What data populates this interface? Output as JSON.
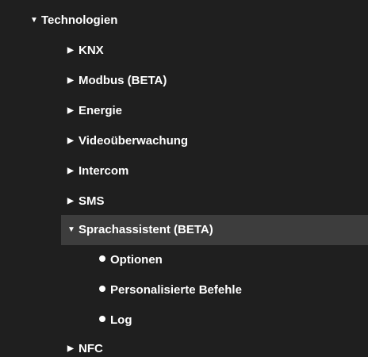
{
  "tree": {
    "root": {
      "label": "Technologien",
      "expand_icon": "triangle-down-icon"
    },
    "items": [
      {
        "label": "KNX",
        "icon": "triangle-right-icon"
      },
      {
        "label": "Modbus (BETA)",
        "icon": "triangle-right-icon"
      },
      {
        "label": "Energie",
        "icon": "triangle-right-icon"
      },
      {
        "label": "Videoüberwachung",
        "icon": "triangle-right-icon"
      },
      {
        "label": "Intercom",
        "icon": "triangle-right-icon"
      },
      {
        "label": "SMS",
        "icon": "triangle-right-icon"
      },
      {
        "label": "Sprachassistent (BETA)",
        "icon": "triangle-down-icon",
        "expanded": true,
        "children": [
          {
            "label": "Optionen",
            "icon": "bullet-icon"
          },
          {
            "label": "Personalisierte Befehle",
            "icon": "bullet-icon"
          },
          {
            "label": "Log",
            "icon": "bullet-icon"
          }
        ]
      },
      {
        "label": "NFC",
        "icon": "triangle-right-icon"
      }
    ]
  },
  "colors": {
    "background": "#1f1f1f",
    "selected_background": "#3d3d3d",
    "text": "#ffffff"
  }
}
